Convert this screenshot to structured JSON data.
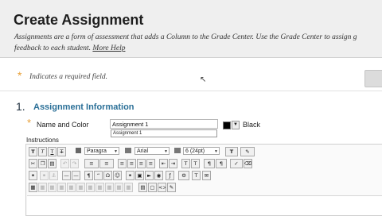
{
  "header": {
    "title": "Create Assignment",
    "description_main": "Assignments are a form of assessment that adds a Column to the Grade Center. Use the Grade Center to assign g",
    "description_second": "feedback to each student.",
    "help_link": "More Help"
  },
  "required_note": {
    "star": "*",
    "text": "Indicates a required field."
  },
  "section": {
    "number": "1.",
    "title": "Assignment Information"
  },
  "name_field": {
    "star": "*",
    "label": "Name and Color",
    "value": "Assignment 1",
    "suggestion": "Assignment 1",
    "color_name": "Black",
    "color_hex": "#000000"
  },
  "instructions": {
    "label": "Instructions",
    "format_select": "Paragra",
    "font_select": "Arial",
    "size_select": "6 (24pt)"
  },
  "icons": {
    "bold": "T",
    "italic": "T",
    "underline": "T",
    "strike": "T",
    "text_color": "T"
  },
  "colors": {
    "header_bg": "#efefef",
    "accent_star": "#e8a038",
    "section_title": "#2a6f97"
  }
}
